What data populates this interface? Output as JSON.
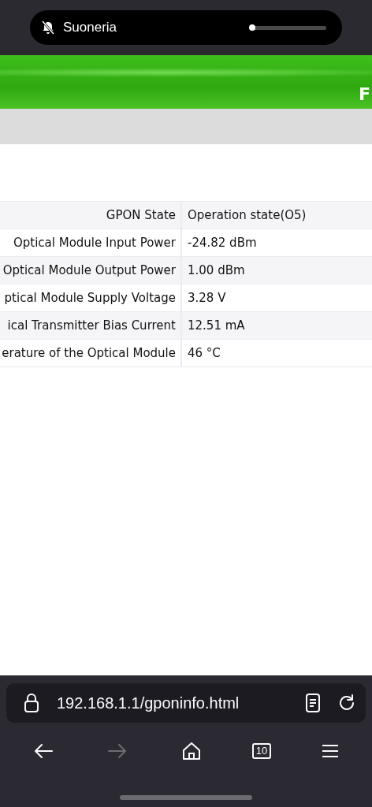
{
  "ringer": {
    "label": "Suoneria",
    "muted": true,
    "level": 0.02
  },
  "banner": {
    "text": "F"
  },
  "table": {
    "rows": [
      {
        "label": "GPON State",
        "value": "Operation state(O5)"
      },
      {
        "label": "Optical Module Input Power",
        "value": "-24.82 dBm"
      },
      {
        "label": "Optical Module Output Power",
        "value": "1.00 dBm"
      },
      {
        "label": "ptical Module Supply Voltage",
        "value": "3.28 V"
      },
      {
        "label": "ical Transmitter Bias Current",
        "value": "12.51 mA"
      },
      {
        "label": "erature of the Optical Module",
        "value": "46 °C"
      }
    ]
  },
  "browser": {
    "url": "192.168.1.1/gponinfo.html",
    "back_disabled": false,
    "forward_disabled": true,
    "tab_count": "10"
  }
}
